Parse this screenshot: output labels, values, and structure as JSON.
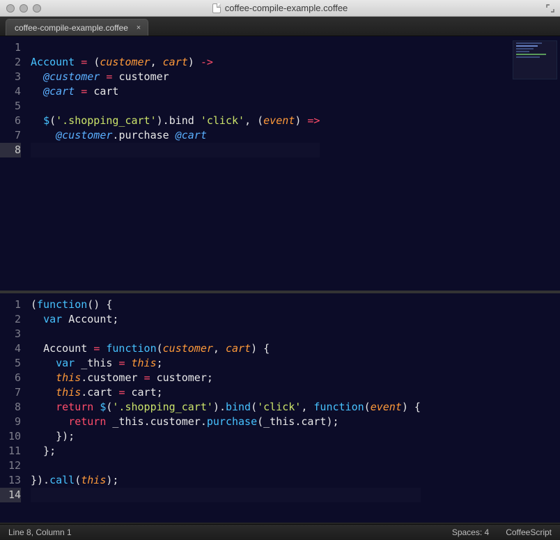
{
  "window": {
    "title": "coffee-compile-example.coffee"
  },
  "tab": {
    "label": "coffee-compile-example.coffee"
  },
  "status": {
    "position": "Line 8, Column 1",
    "spaces": "Spaces: 4",
    "syntax": "CoffeeScript"
  },
  "top_pane": {
    "cursor_line": 8,
    "line_count": 8,
    "lines": [
      {
        "n": 1,
        "tokens": []
      },
      {
        "n": 2,
        "tokens": [
          {
            "t": "Account",
            "c": "nm"
          },
          {
            "t": " "
          },
          {
            "t": "=",
            "c": "op"
          },
          {
            "t": " "
          },
          {
            "t": "(",
            "c": "punct"
          },
          {
            "t": "customer",
            "c": "par"
          },
          {
            "t": ", ",
            "c": "punct"
          },
          {
            "t": "cart",
            "c": "par"
          },
          {
            "t": ")",
            "c": "punct"
          },
          {
            "t": " "
          },
          {
            "t": "->",
            "c": "op"
          }
        ]
      },
      {
        "n": 3,
        "tokens": [
          {
            "t": "  "
          },
          {
            "t": "@customer",
            "c": "atv"
          },
          {
            "t": " "
          },
          {
            "t": "=",
            "c": "op"
          },
          {
            "t": " "
          },
          {
            "t": "customer",
            "c": "prop"
          }
        ]
      },
      {
        "n": 4,
        "tokens": [
          {
            "t": "  "
          },
          {
            "t": "@cart",
            "c": "atv"
          },
          {
            "t": " "
          },
          {
            "t": "=",
            "c": "op"
          },
          {
            "t": " "
          },
          {
            "t": "cart",
            "c": "prop"
          }
        ]
      },
      {
        "n": 5,
        "tokens": []
      },
      {
        "n": 6,
        "tokens": [
          {
            "t": "  "
          },
          {
            "t": "$",
            "c": "dol"
          },
          {
            "t": "(",
            "c": "punct"
          },
          {
            "t": "'.shopping_cart'",
            "c": "str"
          },
          {
            "t": ")",
            "c": "punct"
          },
          {
            "t": ".",
            "c": "punct"
          },
          {
            "t": "bind",
            "c": "prop"
          },
          {
            "t": " "
          },
          {
            "t": "'click'",
            "c": "str"
          },
          {
            "t": ", ",
            "c": "punct"
          },
          {
            "t": "(",
            "c": "punct"
          },
          {
            "t": "event",
            "c": "par"
          },
          {
            "t": ")",
            "c": "punct"
          },
          {
            "t": " "
          },
          {
            "t": "=>",
            "c": "op"
          }
        ]
      },
      {
        "n": 7,
        "tokens": [
          {
            "t": "    "
          },
          {
            "t": "@customer",
            "c": "atv"
          },
          {
            "t": ".",
            "c": "punct"
          },
          {
            "t": "purchase",
            "c": "prop"
          },
          {
            "t": " "
          },
          {
            "t": "@cart",
            "c": "atv"
          }
        ]
      },
      {
        "n": 8,
        "tokens": []
      }
    ]
  },
  "bottom_pane": {
    "cursor_line": 14,
    "line_count": 14,
    "lines": [
      {
        "n": 1,
        "tokens": [
          {
            "t": "(",
            "c": "punct"
          },
          {
            "t": "function",
            "c": "fn"
          },
          {
            "t": "()",
            "c": "punct"
          },
          {
            "t": " {",
            "c": "punct"
          }
        ]
      },
      {
        "n": 2,
        "tokens": [
          {
            "t": "  "
          },
          {
            "t": "var",
            "c": "fn"
          },
          {
            "t": " "
          },
          {
            "t": "Account",
            "c": "prop"
          },
          {
            "t": ";",
            "c": "punct"
          }
        ]
      },
      {
        "n": 3,
        "tokens": []
      },
      {
        "n": 4,
        "tokens": [
          {
            "t": "  "
          },
          {
            "t": "Account",
            "c": "prop"
          },
          {
            "t": " "
          },
          {
            "t": "=",
            "c": "op"
          },
          {
            "t": " "
          },
          {
            "t": "function",
            "c": "fn"
          },
          {
            "t": "(",
            "c": "punct"
          },
          {
            "t": "customer",
            "c": "par"
          },
          {
            "t": ", ",
            "c": "punct"
          },
          {
            "t": "cart",
            "c": "par"
          },
          {
            "t": ")",
            "c": "punct"
          },
          {
            "t": " {",
            "c": "punct"
          }
        ]
      },
      {
        "n": 5,
        "tokens": [
          {
            "t": "    "
          },
          {
            "t": "var",
            "c": "fn"
          },
          {
            "t": " "
          },
          {
            "t": "_this",
            "c": "prop"
          },
          {
            "t": " "
          },
          {
            "t": "=",
            "c": "op"
          },
          {
            "t": " "
          },
          {
            "t": "this",
            "c": "thisk"
          },
          {
            "t": ";",
            "c": "punct"
          }
        ]
      },
      {
        "n": 6,
        "tokens": [
          {
            "t": "    "
          },
          {
            "t": "this",
            "c": "thisk"
          },
          {
            "t": ".",
            "c": "punct"
          },
          {
            "t": "customer",
            "c": "prop"
          },
          {
            "t": " "
          },
          {
            "t": "=",
            "c": "op"
          },
          {
            "t": " "
          },
          {
            "t": "customer",
            "c": "prop"
          },
          {
            "t": ";",
            "c": "punct"
          }
        ]
      },
      {
        "n": 7,
        "tokens": [
          {
            "t": "    "
          },
          {
            "t": "this",
            "c": "thisk"
          },
          {
            "t": ".",
            "c": "punct"
          },
          {
            "t": "cart",
            "c": "prop"
          },
          {
            "t": " "
          },
          {
            "t": "=",
            "c": "op"
          },
          {
            "t": " "
          },
          {
            "t": "cart",
            "c": "prop"
          },
          {
            "t": ";",
            "c": "punct"
          }
        ]
      },
      {
        "n": 8,
        "tokens": [
          {
            "t": "    "
          },
          {
            "t": "return",
            "c": "kw"
          },
          {
            "t": " "
          },
          {
            "t": "$",
            "c": "dol"
          },
          {
            "t": "(",
            "c": "punct"
          },
          {
            "t": "'.shopping_cart'",
            "c": "str"
          },
          {
            "t": ")",
            "c": "punct"
          },
          {
            "t": ".",
            "c": "punct"
          },
          {
            "t": "bind",
            "c": "fn"
          },
          {
            "t": "(",
            "c": "punct"
          },
          {
            "t": "'click'",
            "c": "str"
          },
          {
            "t": ", ",
            "c": "punct"
          },
          {
            "t": "function",
            "c": "fn"
          },
          {
            "t": "(",
            "c": "punct"
          },
          {
            "t": "event",
            "c": "par"
          },
          {
            "t": ")",
            "c": "punct"
          },
          {
            "t": " {",
            "c": "punct"
          }
        ]
      },
      {
        "n": 9,
        "tokens": [
          {
            "t": "      "
          },
          {
            "t": "return",
            "c": "kw"
          },
          {
            "t": " "
          },
          {
            "t": "_this",
            "c": "prop"
          },
          {
            "t": ".",
            "c": "punct"
          },
          {
            "t": "customer",
            "c": "prop"
          },
          {
            "t": ".",
            "c": "punct"
          },
          {
            "t": "purchase",
            "c": "fn"
          },
          {
            "t": "(",
            "c": "punct"
          },
          {
            "t": "_this",
            "c": "prop"
          },
          {
            "t": ".",
            "c": "punct"
          },
          {
            "t": "cart",
            "c": "prop"
          },
          {
            "t": ");",
            "c": "punct"
          }
        ]
      },
      {
        "n": 10,
        "tokens": [
          {
            "t": "    });",
            "c": "punct"
          }
        ]
      },
      {
        "n": 11,
        "tokens": [
          {
            "t": "  };",
            "c": "punct"
          }
        ]
      },
      {
        "n": 12,
        "tokens": []
      },
      {
        "n": 13,
        "tokens": [
          {
            "t": "}).",
            "c": "punct"
          },
          {
            "t": "call",
            "c": "fn"
          },
          {
            "t": "(",
            "c": "punct"
          },
          {
            "t": "this",
            "c": "thisk"
          },
          {
            "t": ");",
            "c": "punct"
          }
        ]
      },
      {
        "n": 14,
        "tokens": []
      }
    ]
  }
}
